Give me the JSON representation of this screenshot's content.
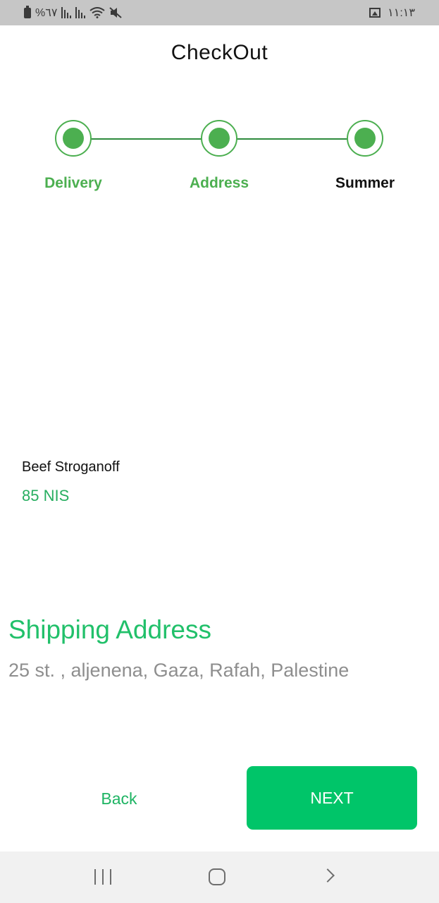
{
  "status_bar": {
    "battery_text": "%٦٧",
    "time": "١١:١٣"
  },
  "header": {
    "title": "CheckOut"
  },
  "stepper": {
    "active_color": "#4caf50",
    "steps": [
      {
        "label": "Delivery",
        "color": "#4caf50"
      },
      {
        "label": "Address",
        "color": "#4caf50"
      },
      {
        "label": "Summer",
        "color": "#111111"
      }
    ]
  },
  "order": {
    "item_name": "Beef Stroganoff",
    "item_price": "85 NIS"
  },
  "shipping": {
    "heading": "Shipping Address",
    "address": "25 st. , aljenena, Gaza, Rafah, Palestine"
  },
  "actions": {
    "back_label": "Back",
    "next_label": "NEXT",
    "next_color": "#00c569"
  },
  "icons": {
    "status": [
      "battery-icon",
      "signal-icon",
      "signal-icon",
      "wifi-icon",
      "mute-icon",
      "gallery-icon"
    ],
    "nav": [
      "recent-apps-icon",
      "home-icon",
      "back-icon"
    ]
  }
}
